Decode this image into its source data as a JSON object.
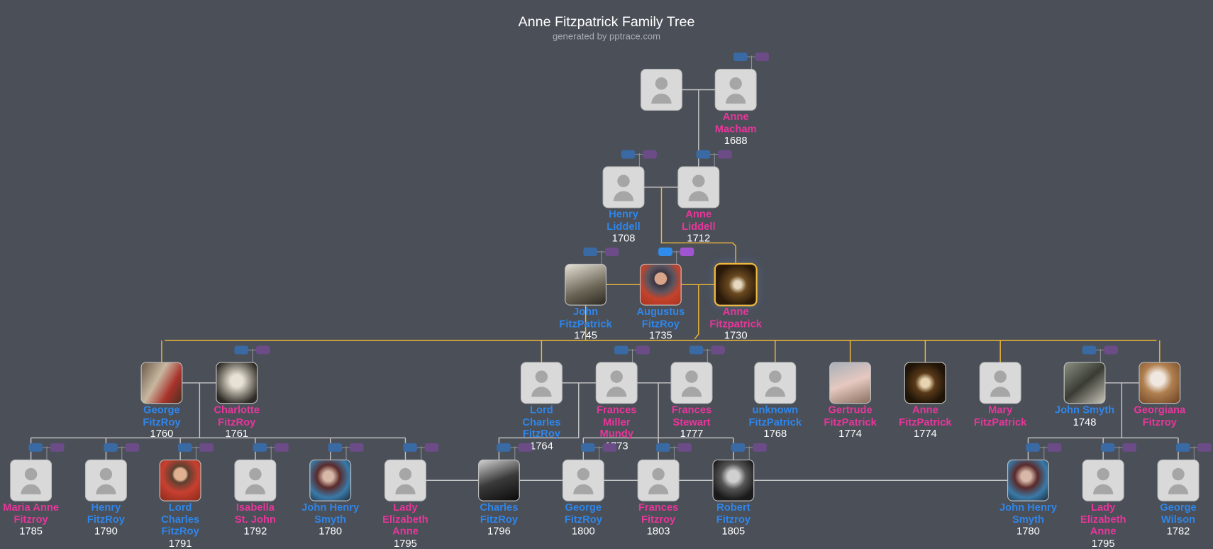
{
  "title": "Anne Fitzpatrick Family Tree",
  "subtitle": "generated by pptrace.com",
  "colors": {
    "background": "#4a4f58",
    "male": "#2f86ea",
    "female": "#e8369b",
    "direct_line": "#f0b93a",
    "relation_line": "#c8c8c8"
  },
  "people": [
    {
      "lines": [],
      "year": "",
      "gender": "u",
      "photo": false,
      "pills": false
    },
    {
      "lines": [
        "Anne",
        "Macham"
      ],
      "year": "1688",
      "gender": "f",
      "photo": false,
      "pills": true
    },
    {
      "lines": [
        "Henry",
        "Liddell"
      ],
      "year": "1708",
      "gender": "m",
      "photo": false,
      "pills": true
    },
    {
      "lines": [
        "Anne",
        "Liddell"
      ],
      "year": "1712",
      "gender": "f",
      "photo": false,
      "pills": true
    },
    {
      "lines": [
        "John",
        "FitzPatrick"
      ],
      "year": "1745",
      "gender": "m",
      "photo": true,
      "pills": true
    },
    {
      "lines": [
        "Augustus",
        "FitzRoy"
      ],
      "year": "1735",
      "gender": "m",
      "photo": true,
      "pills": true,
      "pills_active": true
    },
    {
      "lines": [
        "Anne",
        "Fitzpatrick"
      ],
      "year": "1730",
      "gender": "f",
      "photo": true,
      "pills": false,
      "highlighted": true
    },
    {
      "lines": [
        "George",
        "FitzRoy"
      ],
      "year": "1760",
      "gender": "m",
      "photo": true,
      "pills": false
    },
    {
      "lines": [
        "Charlotte",
        "FitzRoy"
      ],
      "year": "1761",
      "gender": "f",
      "photo": true,
      "pills": true
    },
    {
      "lines": [
        "Lord",
        "Charles",
        "FitzRoy"
      ],
      "year": "1764",
      "gender": "m",
      "photo": false,
      "pills": false
    },
    {
      "lines": [
        "Frances",
        "Miller",
        "Mundy"
      ],
      "year": "1773",
      "gender": "f",
      "photo": false,
      "pills": true
    },
    {
      "lines": [
        "Frances",
        "Stewart"
      ],
      "year": "1777",
      "gender": "f",
      "photo": false,
      "pills": true
    },
    {
      "lines": [
        "unknown",
        "FitzPatrick"
      ],
      "year": "1768",
      "gender": "m",
      "photo": false,
      "pills": false
    },
    {
      "lines": [
        "Gertrude",
        "FitzPatrick"
      ],
      "year": "1774",
      "gender": "f",
      "photo": true,
      "pills": false
    },
    {
      "lines": [
        "Anne",
        "FitzPatrick"
      ],
      "year": "1774",
      "gender": "f",
      "photo": true,
      "pills": false
    },
    {
      "lines": [
        "Mary",
        "FitzPatrick"
      ],
      "year": "",
      "gender": "f",
      "photo": false,
      "pills": false
    },
    {
      "lines": [
        "John Smyth"
      ],
      "year": "1748",
      "gender": "m",
      "photo": true,
      "pills": true
    },
    {
      "lines": [
        "Georgiana",
        "Fitzroy"
      ],
      "year": "",
      "gender": "f",
      "photo": true,
      "pills": false
    },
    {
      "lines": [
        "Maria Anne",
        "Fitzroy"
      ],
      "year": "1785",
      "gender": "f",
      "photo": false,
      "pills": true
    },
    {
      "lines": [
        "Henry",
        "FitzRoy"
      ],
      "year": "1790",
      "gender": "m",
      "photo": false,
      "pills": true
    },
    {
      "lines": [
        "Lord",
        "Charles",
        "FitzRoy"
      ],
      "year": "1791",
      "gender": "m",
      "photo": true,
      "pills": true
    },
    {
      "lines": [
        "Isabella",
        "St. John"
      ],
      "year": "1792",
      "gender": "f",
      "photo": false,
      "pills": true
    },
    {
      "lines": [
        "John Henry",
        "Smyth"
      ],
      "year": "1780",
      "gender": "m",
      "photo": true,
      "pills": true
    },
    {
      "lines": [
        "Lady",
        "Elizabeth",
        "Anne"
      ],
      "year": "1795",
      "gender": "f",
      "photo": false,
      "pills": true
    },
    {
      "lines": [
        "Charles",
        "FitzRoy"
      ],
      "year": "1796",
      "gender": "m",
      "photo": true,
      "pills": true
    },
    {
      "lines": [
        "George",
        "FitzRoy"
      ],
      "year": "1800",
      "gender": "m",
      "photo": false,
      "pills": true
    },
    {
      "lines": [
        "Frances",
        "Fitzroy"
      ],
      "year": "1803",
      "gender": "f",
      "photo": false,
      "pills": true
    },
    {
      "lines": [
        "Robert",
        "Fitzroy"
      ],
      "year": "1805",
      "gender": "m",
      "photo": true,
      "pills": true
    },
    {
      "lines": [
        "John Henry",
        "Smyth"
      ],
      "year": "1780",
      "gender": "m",
      "photo": true,
      "pills": true
    },
    {
      "lines": [
        "Lady",
        "Elizabeth",
        "Anne"
      ],
      "year": "1795",
      "gender": "f",
      "photo": false,
      "pills": true
    },
    {
      "lines": [
        "George",
        "Wilson"
      ],
      "year": "1782",
      "gender": "m",
      "photo": false,
      "pills": true
    }
  ]
}
